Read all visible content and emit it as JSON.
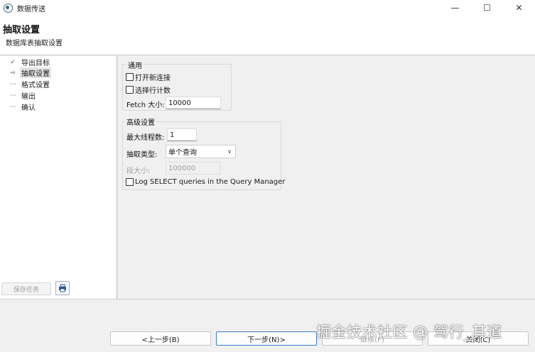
{
  "window": {
    "title": "数据传送",
    "minimize_glyph": "—",
    "maximize_glyph": "☐",
    "close_glyph": "✕"
  },
  "header": {
    "title": "抽取设置",
    "subtitle": "数据库表抽取设置"
  },
  "steps": [
    {
      "label": "导出目标",
      "icon": "✓",
      "state": "done"
    },
    {
      "label": "抽取设置",
      "icon": "⇨",
      "state": "current"
    },
    {
      "label": "格式设置",
      "icon": "⋯",
      "state": "pending"
    },
    {
      "label": "输出",
      "icon": "⋯",
      "state": "pending"
    },
    {
      "label": "确认",
      "icon": "⋯",
      "state": "pending"
    }
  ],
  "left_actions": {
    "save_task": "保存任务"
  },
  "general": {
    "title": "通用",
    "open_new_connection": "打开新连接",
    "select_row_count": "选择行计数",
    "fetch_size_label": "Fetch 大小:",
    "fetch_size_value": "10000"
  },
  "advanced": {
    "title": "高级设置",
    "max_threads_label": "最大线程数:",
    "max_threads_value": "1",
    "extract_type_label": "抽取类型:",
    "extract_type_value": "单个查询",
    "segment_size_label": "段大小:",
    "segment_size_value": "100000",
    "log_select_label": "Log SELECT queries in the Query Manager"
  },
  "footer": {
    "back": "<上一步(B)",
    "next": "下一步(N)>",
    "continue": "继续(F)",
    "close": "关闭(C)"
  },
  "watermark": "掘金技术社区 @ 驾行_其道",
  "colors": {
    "accent": "#3c7fd4",
    "background": "#f0f0f0"
  }
}
